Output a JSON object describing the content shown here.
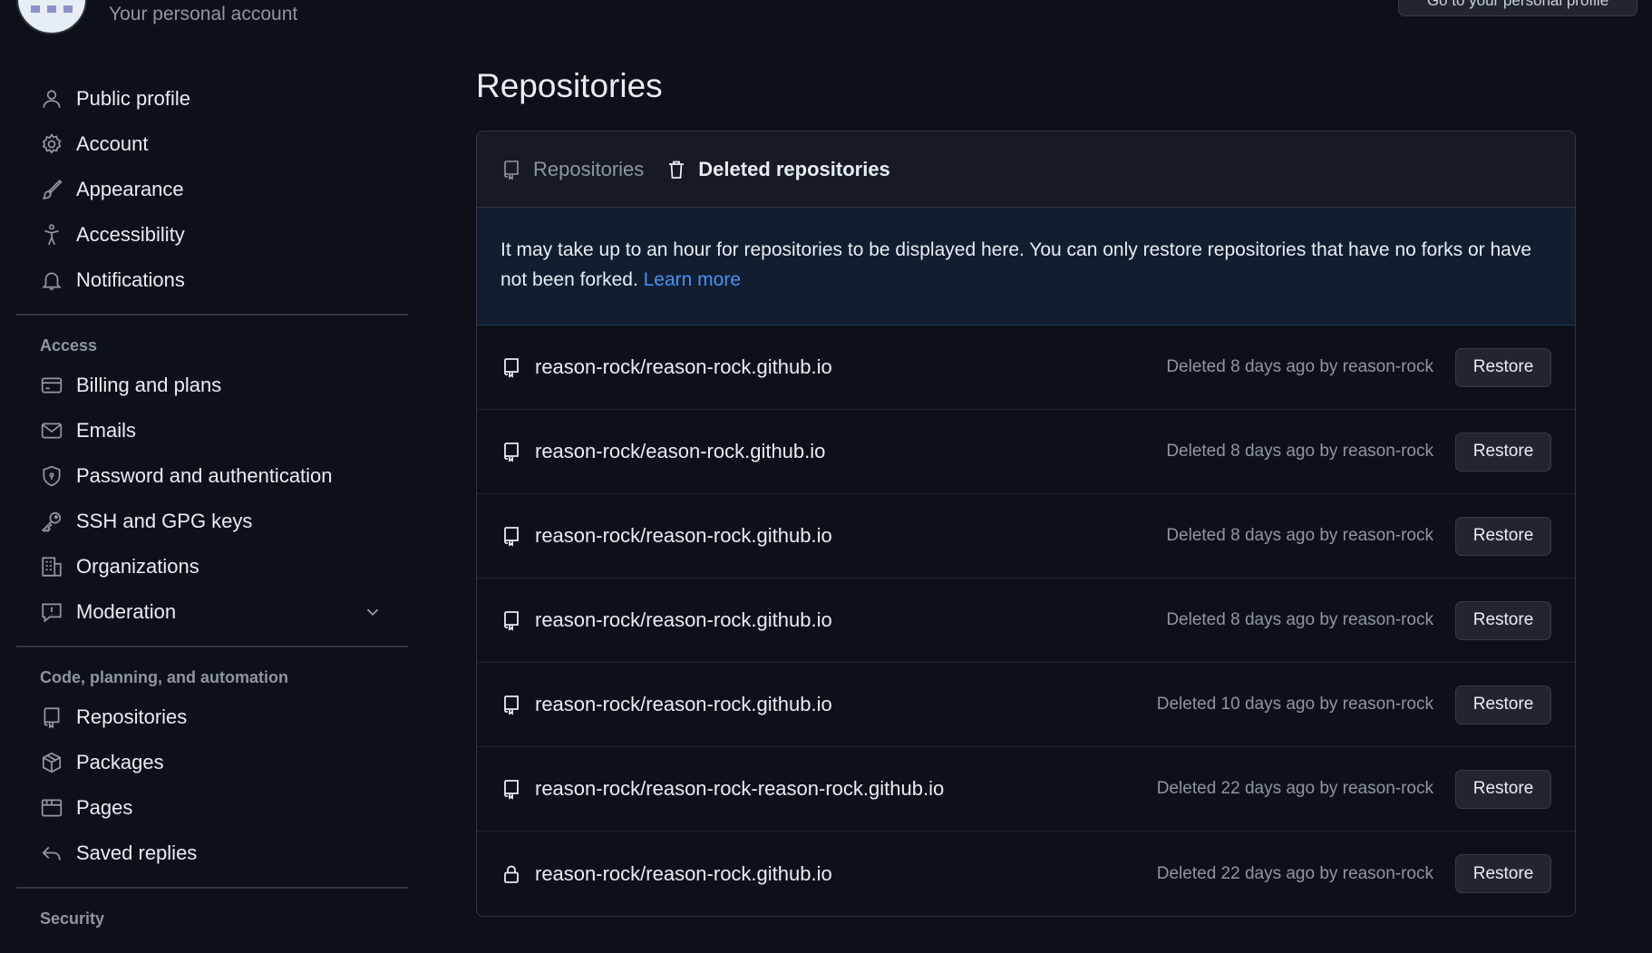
{
  "header": {
    "account_subtitle": "Your personal account",
    "profile_button": "Go to your personal profile"
  },
  "sidebar": {
    "items_top": [
      {
        "label": "Public profile",
        "icon": "person-icon"
      },
      {
        "label": "Account",
        "icon": "gear-icon"
      },
      {
        "label": "Appearance",
        "icon": "paintbrush-icon"
      },
      {
        "label": "Accessibility",
        "icon": "accessibility-icon"
      },
      {
        "label": "Notifications",
        "icon": "bell-icon"
      }
    ],
    "access_title": "Access",
    "items_access": [
      {
        "label": "Billing and plans",
        "icon": "credit-card-icon"
      },
      {
        "label": "Emails",
        "icon": "mail-icon"
      },
      {
        "label": "Password and authentication",
        "icon": "shield-icon"
      },
      {
        "label": "SSH and GPG keys",
        "icon": "key-icon"
      },
      {
        "label": "Organizations",
        "icon": "organization-icon"
      },
      {
        "label": "Moderation",
        "icon": "report-icon"
      }
    ],
    "code_title": "Code, planning, and automation",
    "items_code": [
      {
        "label": "Repositories",
        "icon": "repo-icon"
      },
      {
        "label": "Packages",
        "icon": "package-icon"
      },
      {
        "label": "Pages",
        "icon": "browser-icon"
      },
      {
        "label": "Saved replies",
        "icon": "reply-icon"
      }
    ],
    "security_title": "Security"
  },
  "main": {
    "title": "Repositories",
    "tabs": [
      {
        "label": "Repositories",
        "icon": "repo-icon"
      },
      {
        "label": "Deleted repositories",
        "icon": "trash-icon"
      }
    ],
    "notice": {
      "text": "It may take up to an hour for repositories to be displayed here. You can only restore repositories that have no forks or have not been forked.",
      "link": "Learn more"
    },
    "restore_label": "Restore",
    "rows": [
      {
        "name": "reason-rock/reason-rock.github.io",
        "meta": "Deleted 8 days ago by reason-rock",
        "icon": "repo-icon"
      },
      {
        "name": "reason-rock/eason-rock.github.io",
        "meta": "Deleted 8 days ago by reason-rock",
        "icon": "repo-icon"
      },
      {
        "name": "reason-rock/reason-rock.github.io",
        "meta": "Deleted 8 days ago by reason-rock",
        "icon": "repo-icon"
      },
      {
        "name": "reason-rock/reason-rock.github.io",
        "meta": "Deleted 8 days ago by reason-rock",
        "icon": "repo-icon"
      },
      {
        "name": "reason-rock/reason-rock.github.io",
        "meta": "Deleted 10 days ago by reason-rock",
        "icon": "repo-icon"
      },
      {
        "name": "reason-rock/reason-rock-reason-rock.github.io",
        "meta": "Deleted 22 days ago by reason-rock",
        "icon": "repo-icon"
      },
      {
        "name": "reason-rock/reason-rock.github.io",
        "meta": "Deleted 22 days ago by reason-rock",
        "icon": "lock-icon"
      }
    ]
  }
}
